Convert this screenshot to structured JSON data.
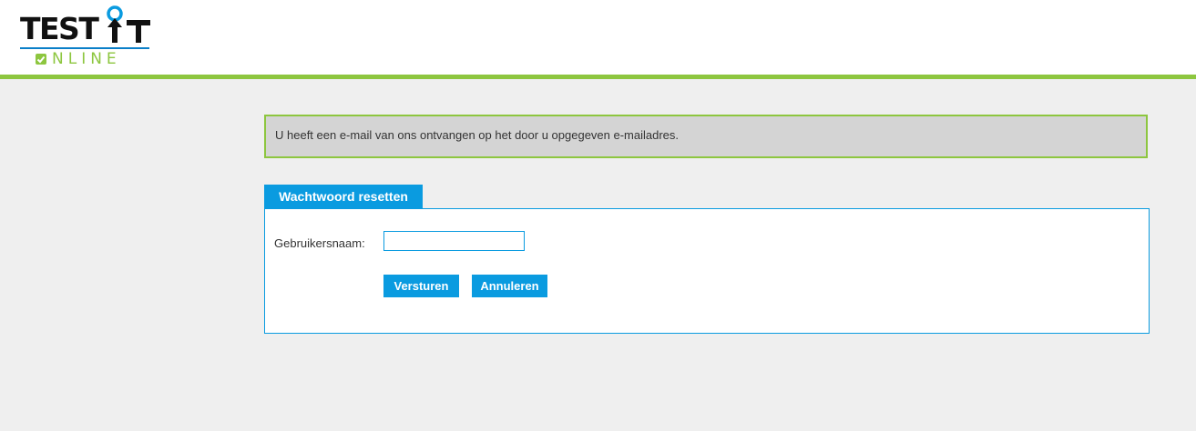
{
  "header": {
    "logo": {
      "text_top": "TEST",
      "text_bottom": "NLINE",
      "icon": "test-it-online-logo"
    }
  },
  "alert": {
    "message": "U heeft een e-mail van ons ontvangen op het door u opgegeven e-mailadres."
  },
  "form": {
    "tab_title": "Wachtwoord resetten",
    "username_label": "Gebruikersnaam:",
    "username_value": "",
    "submit_label": "Versturen",
    "cancel_label": "Annuleren"
  },
  "colors": {
    "accent_blue": "#0a9be0",
    "accent_green": "#8dc63f",
    "background": "#efefef",
    "alert_background": "#d4d4d4"
  }
}
